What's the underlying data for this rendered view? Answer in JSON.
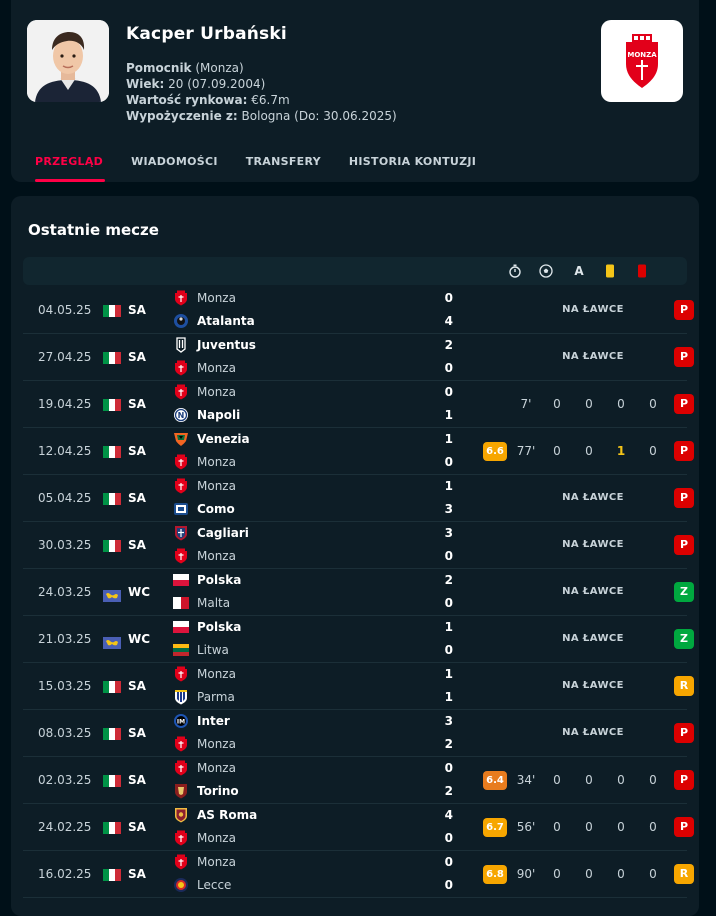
{
  "player": {
    "name": "Kacper Urbański",
    "position_label": "Pomocnik",
    "position_club": "(Monza)",
    "age_label": "Wiek:",
    "age_value": "20 (07.09.2004)",
    "market_label": "Wartość rynkowa:",
    "market_value": "€6.7m",
    "loan_label": "Wypożyczenie z:",
    "loan_value": "Bologna (Do: 30.06.2025)"
  },
  "tabs": [
    "PRZEGLĄD",
    "WIADOMOŚCI",
    "TRANSFERY",
    "HISTORIA KONTUZJI"
  ],
  "section_title": "Ostatnie mecze",
  "colors": {
    "accent": "#ff0046",
    "loss": "#dc0000",
    "win": "#00a83f",
    "draw": "#f7a600",
    "rating_orange": "#f7a600",
    "rating_dark_orange": "#e87c1e"
  },
  "matches": [
    {
      "date": "04.05.25",
      "comp": "SA",
      "comp_flag": "italy",
      "home": "Monza",
      "away": "Atalanta",
      "home_score": "0",
      "away_score": "4",
      "winner": "away",
      "bench": "NA ŁAWCE",
      "result": "P"
    },
    {
      "date": "27.04.25",
      "comp": "SA",
      "comp_flag": "italy",
      "home": "Juventus",
      "away": "Monza",
      "home_score": "2",
      "away_score": "0",
      "winner": "home",
      "bench": "NA ŁAWCE",
      "result": "P"
    },
    {
      "date": "19.04.25",
      "comp": "SA",
      "comp_flag": "italy",
      "home": "Monza",
      "away": "Napoli",
      "home_score": "0",
      "away_score": "1",
      "winner": "away",
      "minutes": "7'",
      "goals": "0",
      "assists": "0",
      "yellow": "0",
      "red": "0",
      "result": "P"
    },
    {
      "date": "12.04.25",
      "comp": "SA",
      "comp_flag": "italy",
      "home": "Venezia",
      "away": "Monza",
      "home_score": "1",
      "away_score": "0",
      "winner": "home",
      "rating": "6.6",
      "minutes": "77'",
      "goals": "0",
      "assists": "0",
      "yellow": "1",
      "red": "0",
      "result": "P"
    },
    {
      "date": "05.04.25",
      "comp": "SA",
      "comp_flag": "italy",
      "home": "Monza",
      "away": "Como",
      "home_score": "1",
      "away_score": "3",
      "winner": "away",
      "bench": "NA ŁAWCE",
      "result": "P"
    },
    {
      "date": "30.03.25",
      "comp": "SA",
      "comp_flag": "italy",
      "home": "Cagliari",
      "away": "Monza",
      "home_score": "3",
      "away_score": "0",
      "winner": "home",
      "bench": "NA ŁAWCE",
      "result": "P"
    },
    {
      "date": "24.03.25",
      "comp": "WC",
      "comp_flag": "world",
      "home": "Polska",
      "away": "Malta",
      "home_score": "2",
      "away_score": "0",
      "winner": "home",
      "bench": "NA ŁAWCE",
      "result": "Z"
    },
    {
      "date": "21.03.25",
      "comp": "WC",
      "comp_flag": "world",
      "home": "Polska",
      "away": "Litwa",
      "home_score": "1",
      "away_score": "0",
      "winner": "home",
      "bench": "NA ŁAWCE",
      "result": "Z"
    },
    {
      "date": "15.03.25",
      "comp": "SA",
      "comp_flag": "italy",
      "home": "Monza",
      "away": "Parma",
      "home_score": "1",
      "away_score": "1",
      "winner": "none",
      "bench": "NA ŁAWCE",
      "result": "R"
    },
    {
      "date": "08.03.25",
      "comp": "SA",
      "comp_flag": "italy",
      "home": "Inter",
      "away": "Monza",
      "home_score": "3",
      "away_score": "2",
      "winner": "home",
      "bench": "NA ŁAWCE",
      "result": "P"
    },
    {
      "date": "02.03.25",
      "comp": "SA",
      "comp_flag": "italy",
      "home": "Monza",
      "away": "Torino",
      "home_score": "0",
      "away_score": "2",
      "winner": "away",
      "rating": "6.4",
      "minutes": "34'",
      "goals": "0",
      "assists": "0",
      "yellow": "0",
      "red": "0",
      "result": "P"
    },
    {
      "date": "24.02.25",
      "comp": "SA",
      "comp_flag": "italy",
      "home": "AS Roma",
      "away": "Monza",
      "home_score": "4",
      "away_score": "0",
      "winner": "home",
      "rating": "6.7",
      "minutes": "56'",
      "goals": "0",
      "assists": "0",
      "yellow": "0",
      "red": "0",
      "result": "P"
    },
    {
      "date": "16.02.25",
      "comp": "SA",
      "comp_flag": "italy",
      "home": "Monza",
      "away": "Lecce",
      "home_score": "0",
      "away_score": "0",
      "winner": "none",
      "rating": "6.8",
      "minutes": "90'",
      "goals": "0",
      "assists": "0",
      "yellow": "0",
      "red": "0",
      "result": "R"
    }
  ]
}
